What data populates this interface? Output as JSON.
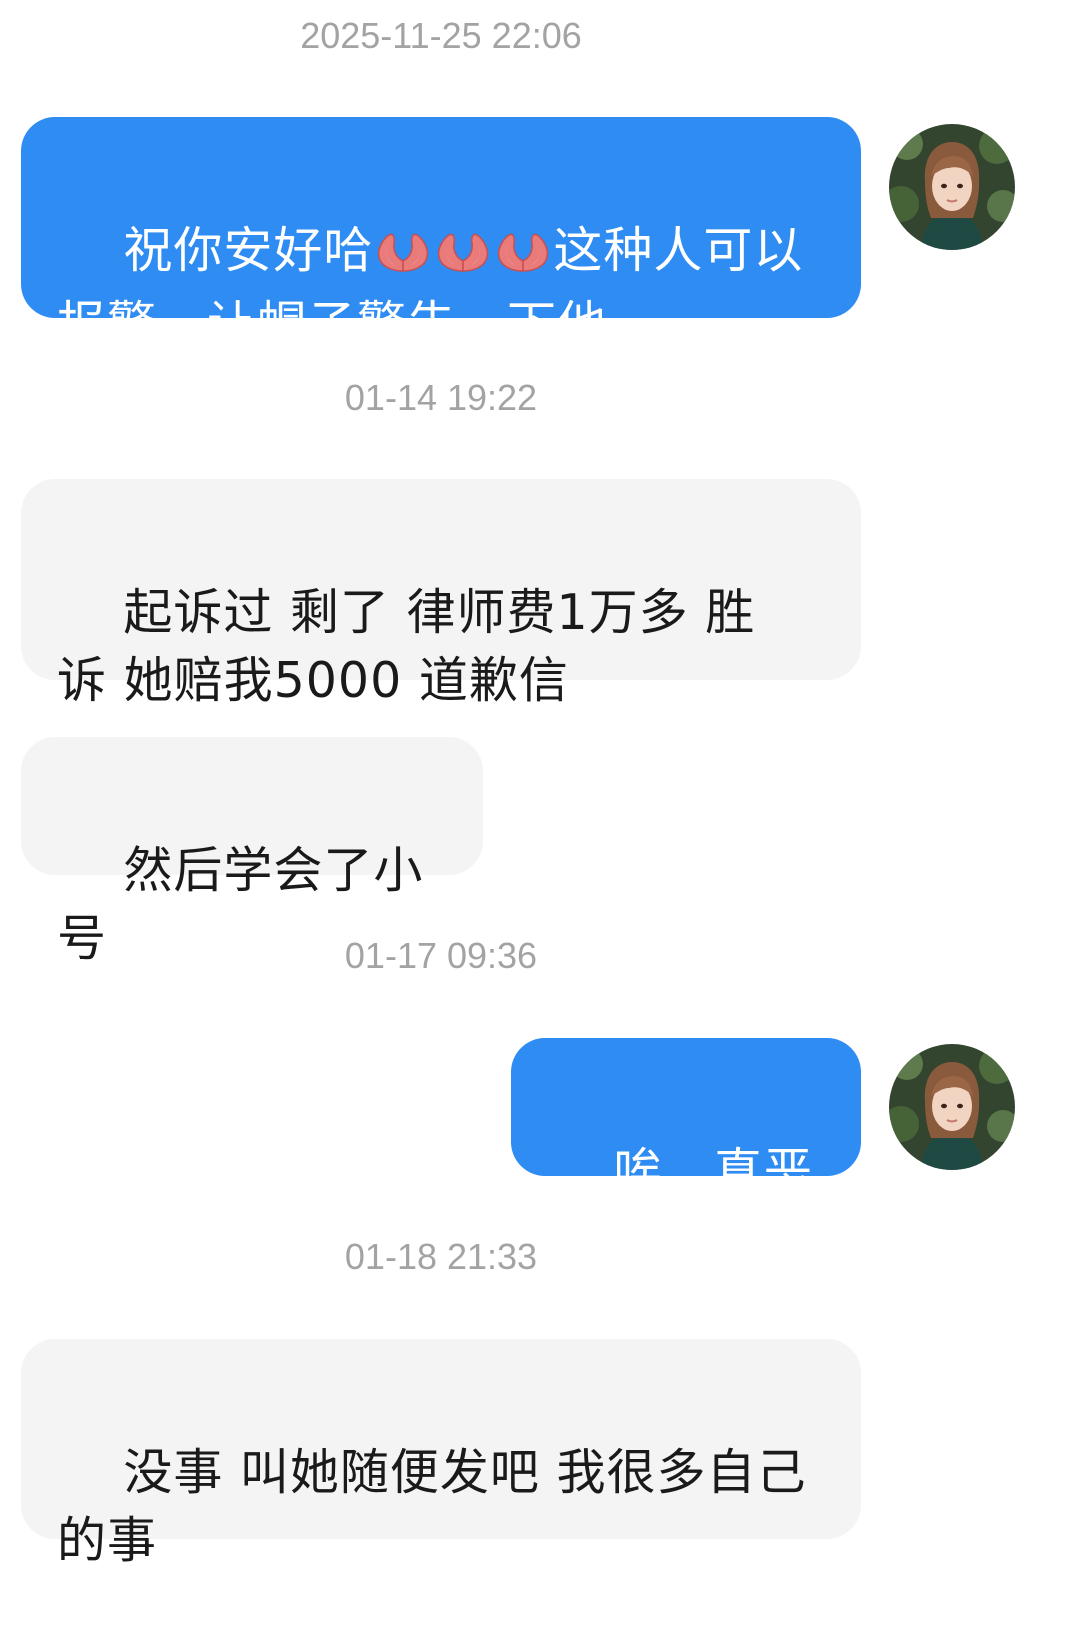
{
  "chat": {
    "messages": [
      {
        "type": "timestamp",
        "text": "2025-11-25 22:06"
      },
      {
        "type": "outgoing",
        "text_before": "祝你安好哈",
        "emoji": [
          "pray-emoji",
          "pray-emoji",
          "pray-emoji"
        ],
        "text_after": "这种人可以报警，让帽子警告一下他"
      },
      {
        "type": "timestamp",
        "text": "01-14 19:22"
      },
      {
        "type": "incoming",
        "text": "起诉过 剩了 律师费1万多 胜诉 她赔我5000 道歉信"
      },
      {
        "type": "incoming",
        "text": "然后学会了小号"
      },
      {
        "type": "timestamp",
        "text": "01-17 09:36"
      },
      {
        "type": "outgoing",
        "text": "唉，真恶心"
      },
      {
        "type": "timestamp",
        "text": "01-18 21:33"
      },
      {
        "type": "incoming",
        "text": "没事 叫她随便发吧 我很多自己的事"
      }
    ]
  },
  "colors": {
    "outgoing_bubble": "#2e8cf3",
    "incoming_bubble": "#f4f4f4",
    "timestamp": "#a3a3a3"
  }
}
